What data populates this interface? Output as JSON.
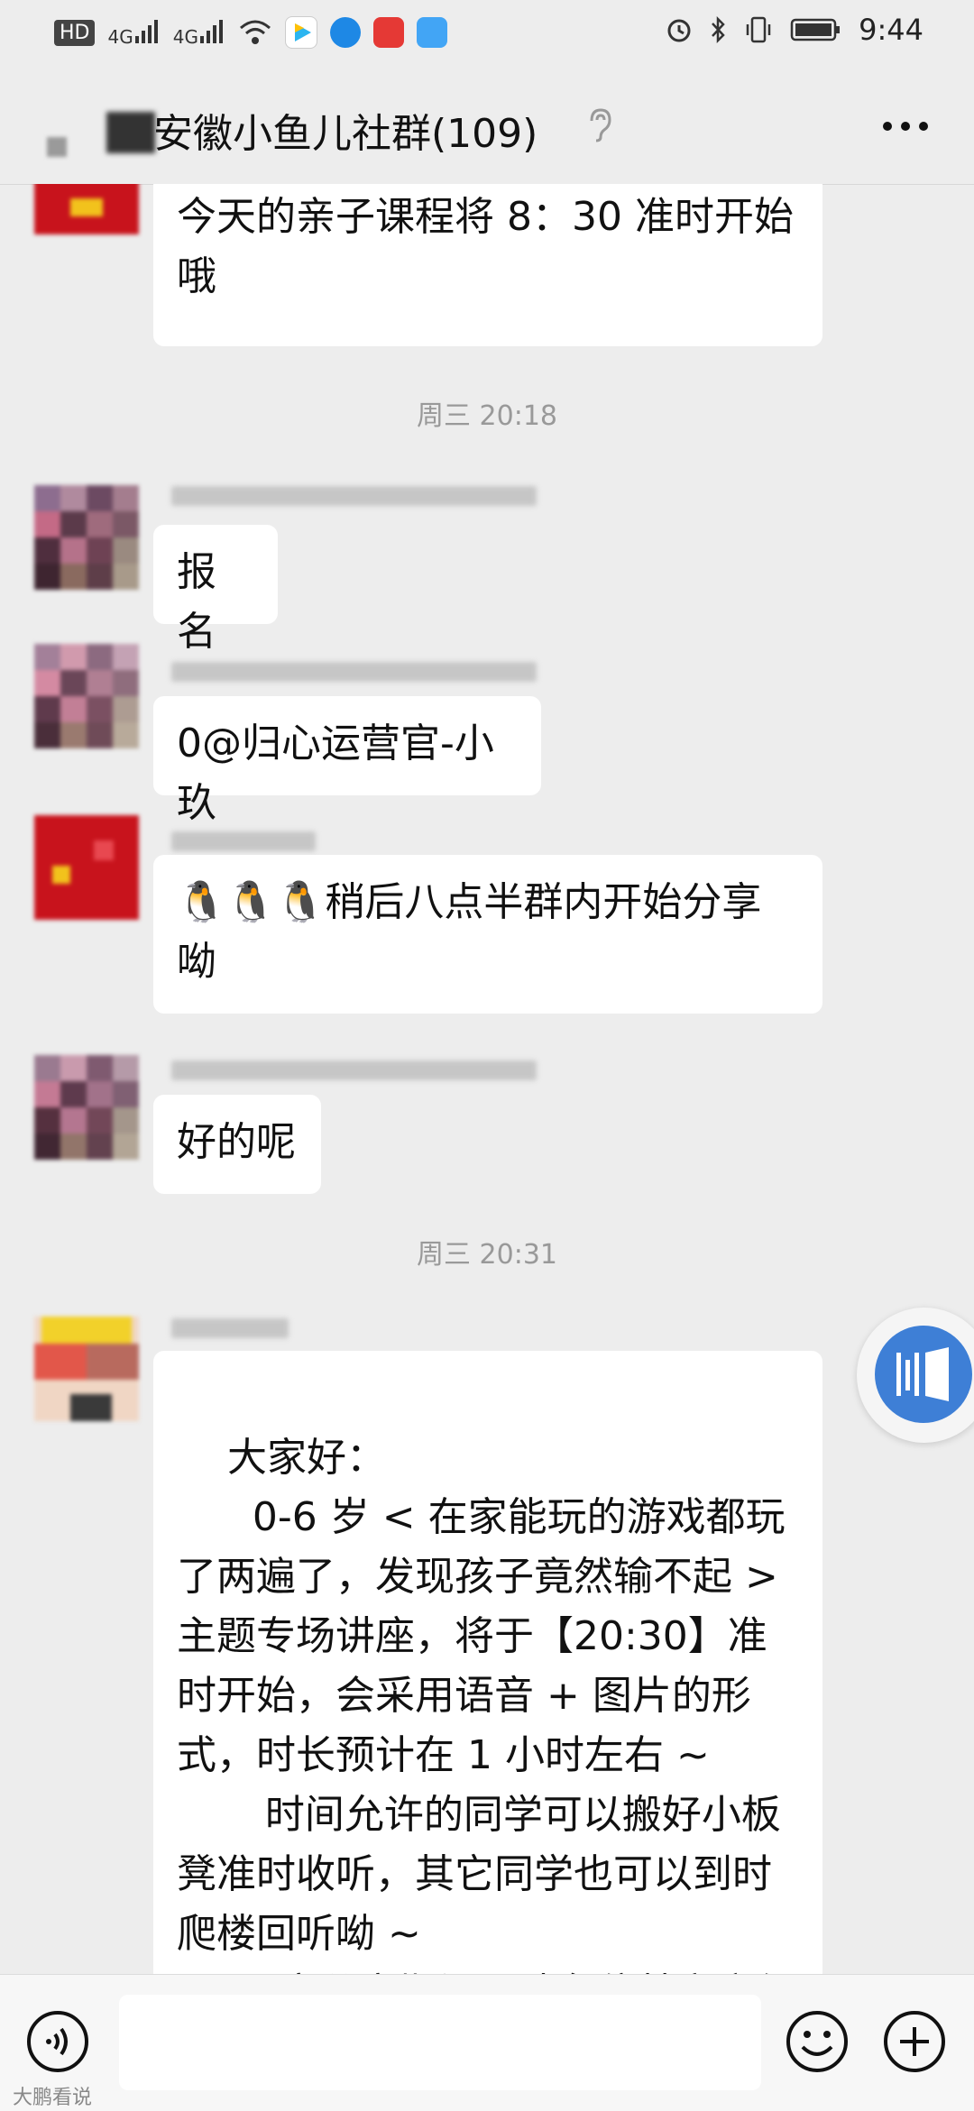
{
  "status_bar": {
    "time": "9:44",
    "network_left": "HD",
    "sig1": "4G",
    "sig2": "4G"
  },
  "header": {
    "title": "安徽小鱼儿社群(109)",
    "more_label": "···"
  },
  "messages": [
    {
      "text": "今天的亲子课程将 8：30 准时开始哦"
    },
    {
      "time": "周三 20:18"
    },
    {
      "text": "报名"
    },
    {
      "text": "0@归心运营官-小玖"
    },
    {
      "text": "🐧🐧🐧稍后八点半群内开始分享呦"
    },
    {
      "text": "好的呢"
    },
    {
      "time": "周三 20:31"
    },
    {
      "text": "大家好：\n      0-6 岁 < 在家能玩的游戏都玩了两遍了，发现孩子竟然输不起 > 主题专场讲座，将于【20:30】准时开始，会采用语音 + 图片的形式，时长预计在 1 小时左右 ~\n       时间允许的同学可以搬好小板凳准时收听，其它同学也可以到时爬楼回听呦 ~\n     语音分享期间，请各位禁言方便"
    }
  ],
  "input": {
    "value": "",
    "placeholder": ""
  },
  "watermark": "大鹏看说",
  "colors": {
    "background": "#ededed",
    "bubble": "#ffffff",
    "accent": "#3e7fd6"
  }
}
